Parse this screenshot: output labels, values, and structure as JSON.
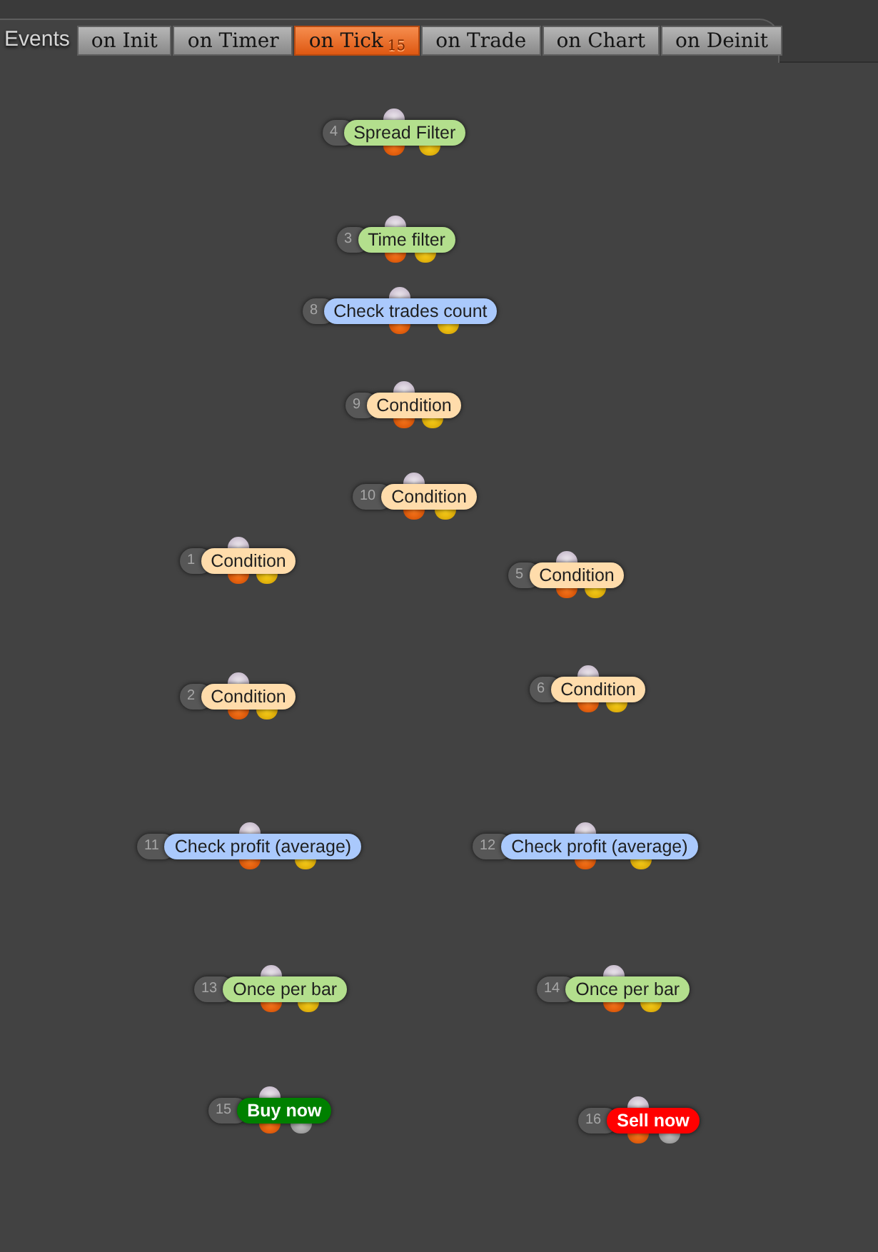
{
  "header": {
    "label": "Events"
  },
  "tabs": [
    {
      "label": "on Init",
      "selected": false
    },
    {
      "label": "on Timer",
      "selected": false
    },
    {
      "label": "on Tick",
      "selected": true,
      "badge": "15"
    },
    {
      "label": "on Trade",
      "selected": false
    },
    {
      "label": "on Chart",
      "selected": false
    },
    {
      "label": "on Deinit",
      "selected": false
    }
  ],
  "nodes": [
    {
      "number": "4",
      "label": "Spread Filter",
      "color": "#b3df8d",
      "kind": "block"
    },
    {
      "number": "3",
      "label": "Time filter",
      "color": "#b3df8d",
      "kind": "block"
    },
    {
      "number": "8",
      "label": "Check trades count",
      "color": "#aac9fc",
      "kind": "block"
    },
    {
      "number": "9",
      "label": "Condition",
      "color": "#ffdcab",
      "kind": "block"
    },
    {
      "number": "10",
      "label": "Condition",
      "color": "#ffdcab",
      "kind": "block"
    },
    {
      "number": "1",
      "label": "Condition",
      "color": "#ffdcab",
      "kind": "block"
    },
    {
      "number": "5",
      "label": "Condition",
      "color": "#ffdcab",
      "kind": "block"
    },
    {
      "number": "2",
      "label": "Condition",
      "color": "#ffdcab",
      "kind": "block"
    },
    {
      "number": "6",
      "label": "Condition",
      "color": "#ffdcab",
      "kind": "block"
    },
    {
      "number": "11",
      "label": "Check profit (average)",
      "color": "#aac9fc",
      "kind": "block"
    },
    {
      "number": "12",
      "label": "Check profit (average)",
      "color": "#aac9fc",
      "kind": "block"
    },
    {
      "number": "13",
      "label": "Once per bar",
      "color": "#b3df8d",
      "kind": "block"
    },
    {
      "number": "14",
      "label": "Once per bar",
      "color": "#b3df8d",
      "kind": "block"
    },
    {
      "number": "15",
      "label": "Buy now",
      "color": "#008000",
      "kind": "trade"
    },
    {
      "number": "16",
      "label": "Sell now",
      "color": "#ff0000",
      "kind": "trade"
    }
  ]
}
